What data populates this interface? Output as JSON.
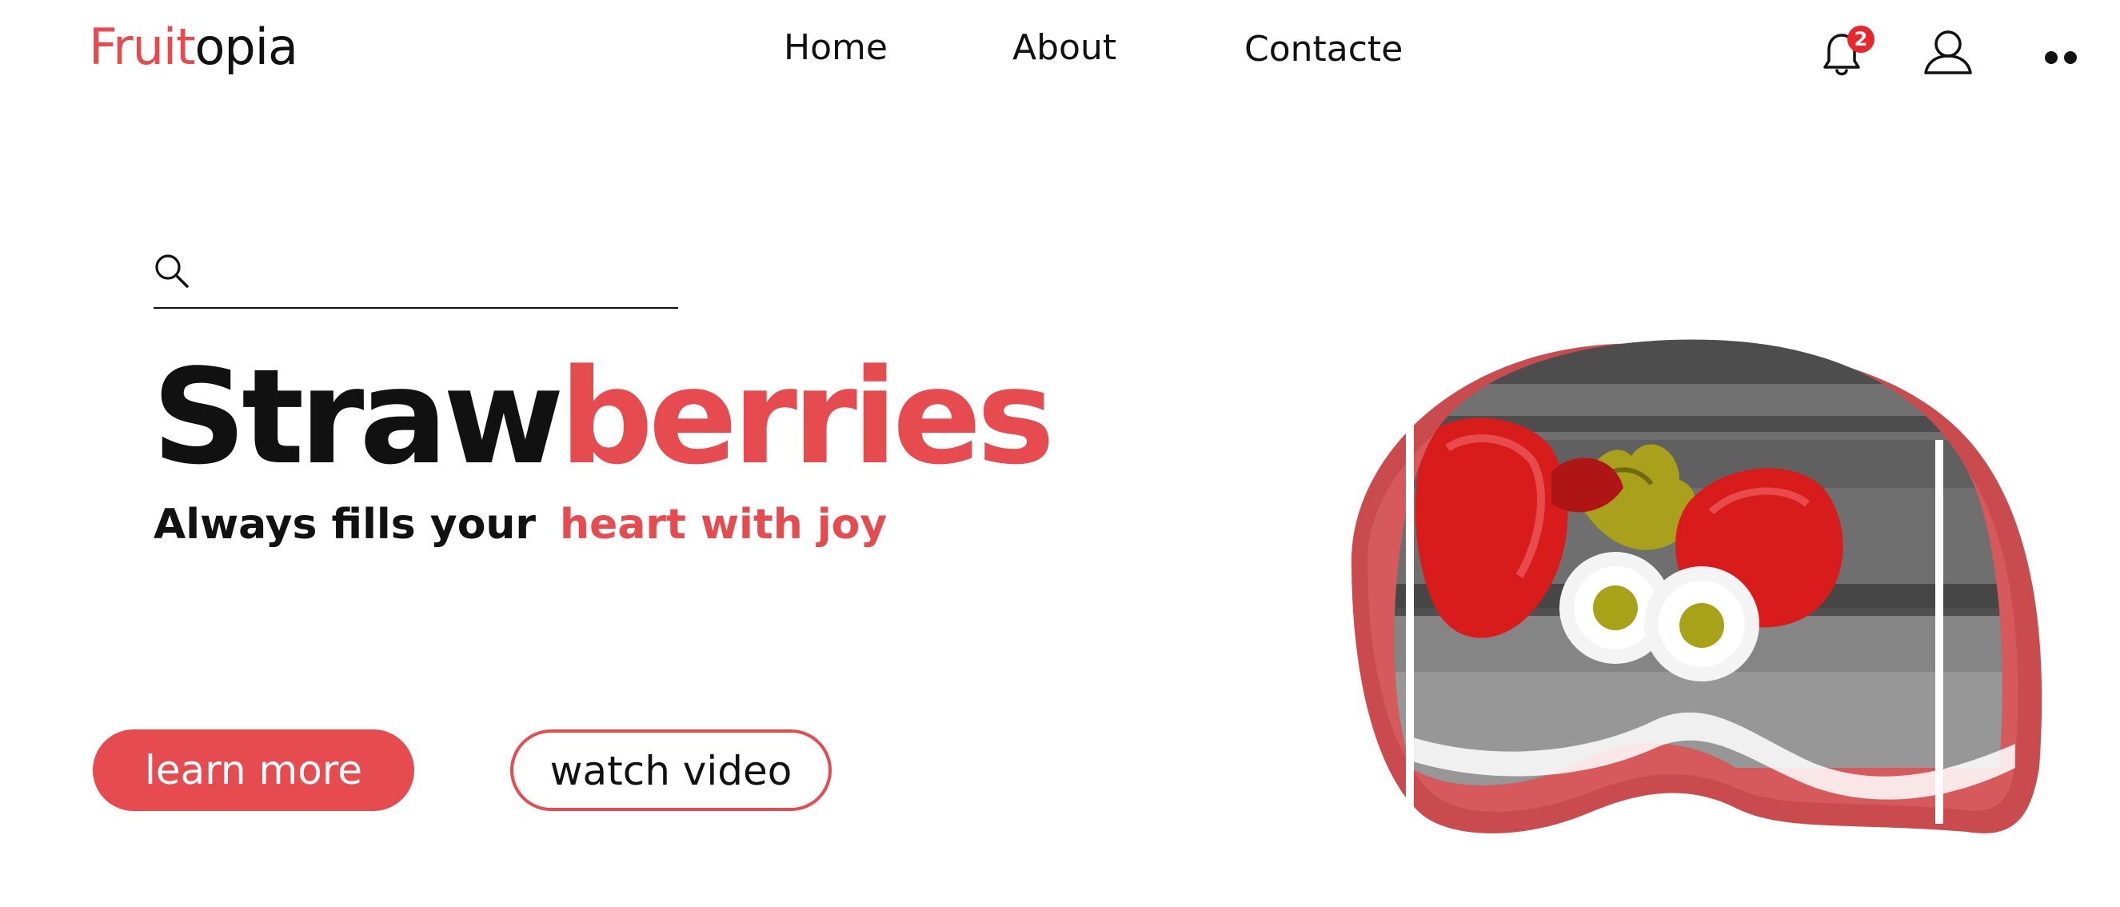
{
  "header": {
    "logo_accent": "Fruit",
    "logo_rest": "opia",
    "nav": [
      {
        "label": "Home"
      },
      {
        "label": "About"
      },
      {
        "label": "Contacte"
      }
    ],
    "notifications": {
      "icon": "bell-icon",
      "badge_count": "2"
    },
    "user_icon": "user-icon",
    "more_icon": "more-dots-icon"
  },
  "search": {
    "icon": "search-icon",
    "value": "",
    "placeholder": ""
  },
  "hero": {
    "title_dark": "Straw",
    "title_red": "berries",
    "tagline_dark": "Always fills your",
    "tagline_red": "heart with joy",
    "image": "strawberries-with-daisies-image"
  },
  "buttons": {
    "learn_more": "learn more",
    "watch_video": "watch video"
  },
  "colors": {
    "accent": "#e64b50",
    "text": "#111111",
    "badge": "#e8262b",
    "background": "#ffffff"
  }
}
